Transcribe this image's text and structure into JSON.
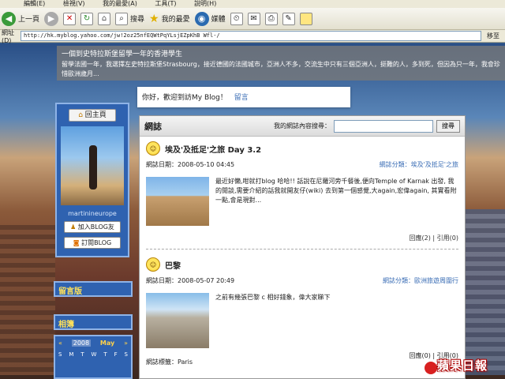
{
  "browser": {
    "menu": [
      "編輯(E)",
      "檢視(V)",
      "我的最愛(A)",
      "工具(T)",
      "說明(H)"
    ],
    "toolbar": {
      "back_label": "上一頁",
      "search_label": "搜尋",
      "favorites_label": "我的最愛",
      "media_label": "媒體"
    },
    "address": {
      "label": "網址(D)",
      "url": "http://hk.myblog.yahoo.com/jw!2oz25nfEQWtPqYLsjEZpKhB Wfl-/",
      "go_label": "移至"
    }
  },
  "banner": {
    "title": "一個到史特拉斯堡留學一年的香港學生",
    "description": "留學法國一年，我選擇左史特拉斯堡Strasbourg，接近德國的法國城市，亞洲人不多，交流生中只有三個亞洲人，挺難的人，多到死，但因為只一年，我會珍惜歐洲歲月..."
  },
  "welcome": {
    "text": "你好，歡迎到訪My Blog！",
    "link": "留言"
  },
  "profile": {
    "home_button": "回主頁",
    "username": "martinineurope",
    "add_friend": "加入BLOG友",
    "subscribe": "訂閱BLOG"
  },
  "sidebar": {
    "guestbook_title": "留言版",
    "album_title": "相簿"
  },
  "calendar": {
    "year": "2008",
    "month": "May",
    "days": [
      "S",
      "M",
      "T",
      "W",
      "T",
      "F",
      "S"
    ]
  },
  "main": {
    "title": "網誌",
    "search_label": "我的網誌內容搜尋：",
    "search_value": "",
    "search_button": "搜尋",
    "posts": [
      {
        "title": "埃及'及抵足'之旅 Day 3.2",
        "date": "網誌日期：2008-05-10 04:45",
        "category": "網誌分類：埃及'及抵足'之旅",
        "excerpt": "最近好懶,咁就打blog 哈哈!! 話說在尼羅河旁千餐後,便向Temple of Karnak 出發, 我的閒談,需要介紹的話我就開友仔(wiki) 去到第一個感覺,大again,宏偉again, 其實看附一點,會是現對...",
        "footer": "回應(2) | 引用(0)"
      },
      {
        "title": "巴黎",
        "date": "網誌日期：2008-05-07 20:49",
        "category": "網誌分類：歐洲旅遊周圍行",
        "excerpt": "之前有幾張巴黎 c 相好錢象，偉大家睇下",
        "tags": "網誌標籤：Paris",
        "footer": "回應(0) | 引用(0)"
      }
    ]
  },
  "watermark": {
    "text": "蘋果日報"
  }
}
